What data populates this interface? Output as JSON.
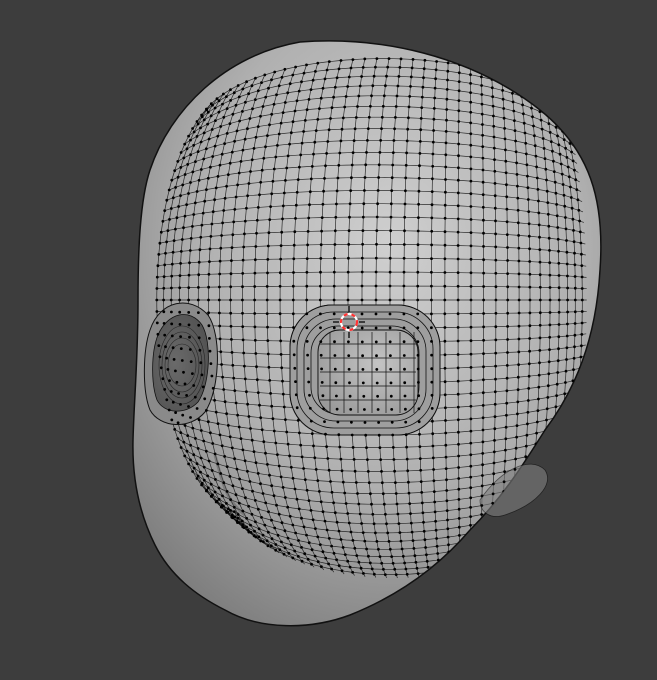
{
  "viewport": {
    "background_color": "#3d3d3d"
  },
  "mesh": {
    "object": "head",
    "mode": "edit",
    "surface_color": "#a8a8a8",
    "surface_highlight": "#cdcdcd",
    "surface_shadow": "#6e6e6e",
    "wire_color": "#111111",
    "vertex_color": "#000000"
  },
  "cursor_3d": {
    "icon": "crosshair-3d-cursor-icon",
    "ring_color_a": "#ff3333",
    "ring_color_b": "#ffffff"
  }
}
